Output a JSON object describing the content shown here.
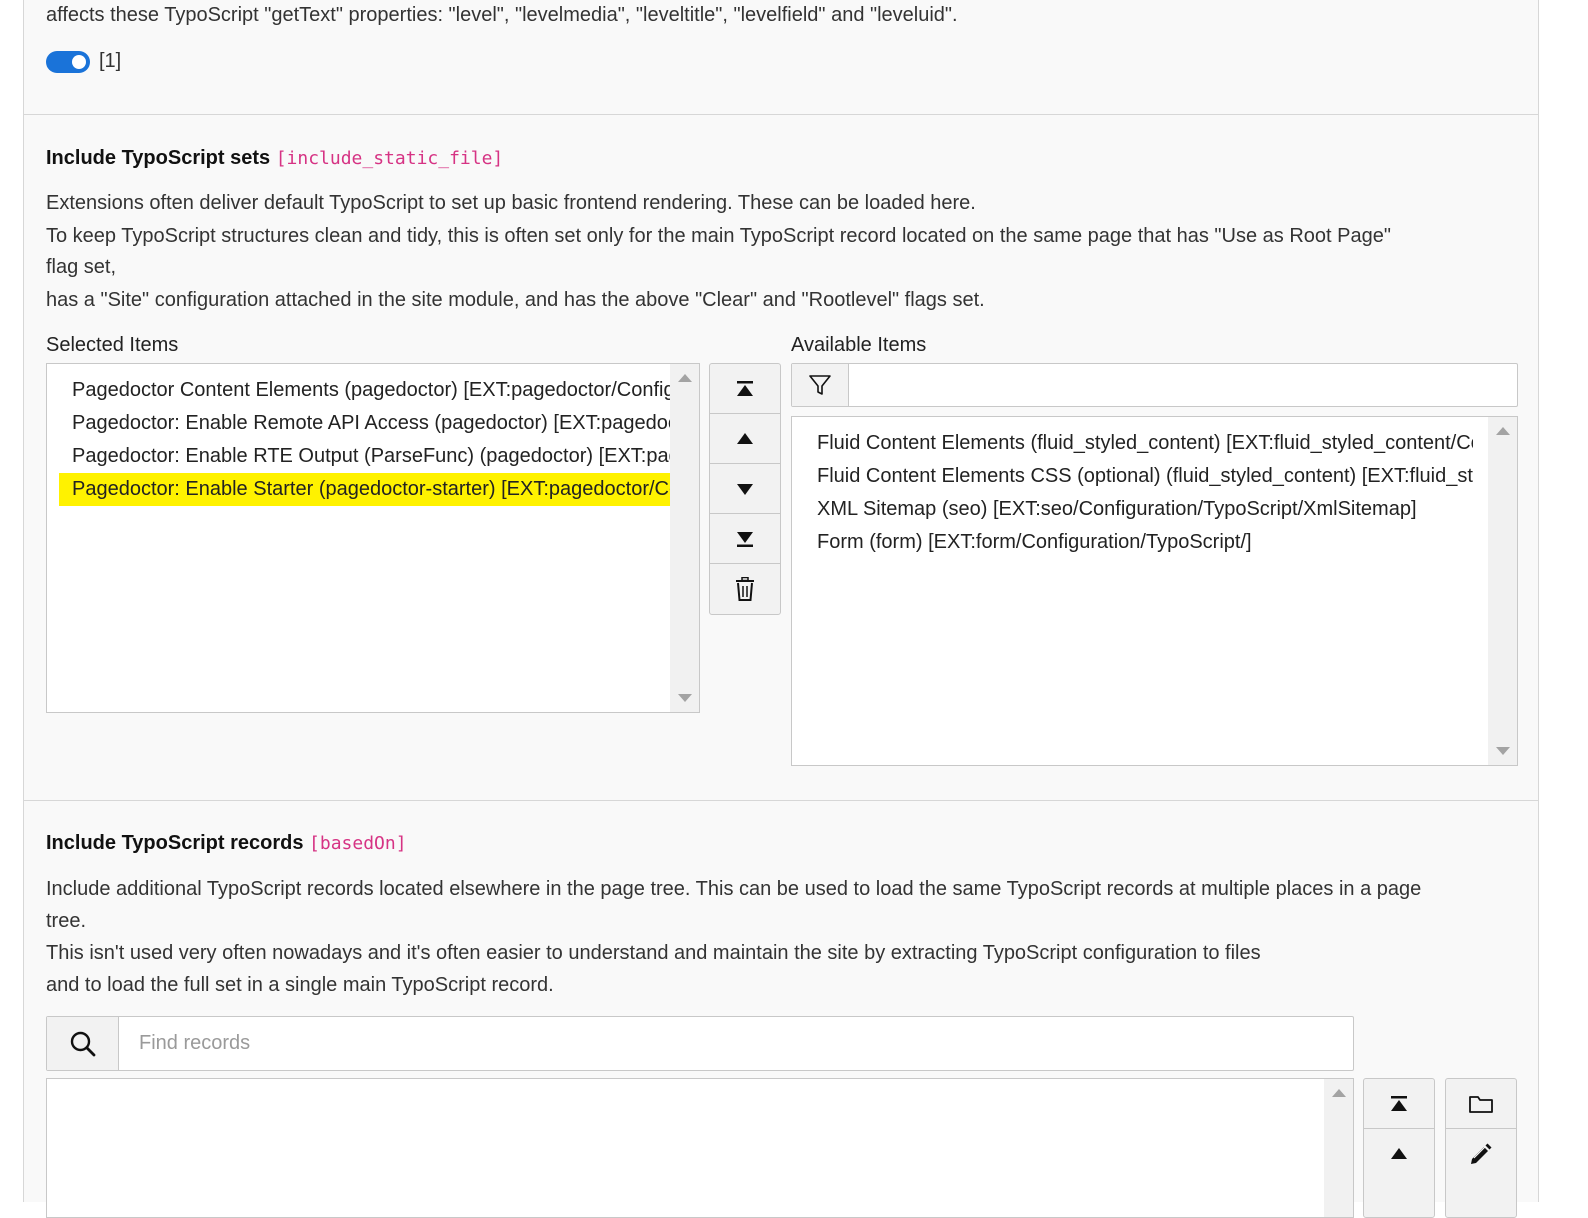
{
  "top": {
    "desc_line": "affects these TypoScript \"getText\" properties: \"level\", \"levelmedia\", \"leveltitle\", \"levelfield\" and \"leveluid\".",
    "toggle_value": "[1]",
    "toggle_on": true
  },
  "include_static": {
    "title": "Include TypoScript sets",
    "field_name": "[include_static_file]",
    "description": [
      "Extensions often deliver default TypoScript to set up basic frontend rendering. These can be loaded here.",
      "To keep TypoScript structures clean and tidy, this is often set only for the main TypoScript record located on the same page that has \"Use as Root Page\"",
      "flag set,",
      "has a \"Site\" configuration attached in the site module, and has the above \"Clear\" and \"Rootlevel\" flags set."
    ],
    "selected_label": "Selected Items",
    "available_label": "Available Items",
    "selected_items": [
      "Pagedoctor Content Elements (pagedoctor) [EXT:pagedoctor/Configuration/TypoScript/]",
      "Pagedoctor: Enable Remote API Access (pagedoctor) [EXT:pagedoctor/Configuration/TypoScript/RemoteApi]",
      "Pagedoctor: Enable RTE Output (ParseFunc) (pagedoctor) [EXT:pagedoctor/Configuration/TypoScript/ParseFunc]",
      "Pagedoctor: Enable Starter (pagedoctor-starter) [EXT:pagedoctor/Configuration/TypoScript/Starter]"
    ],
    "selected_highlight_index": 3,
    "available_items": [
      "Fluid Content Elements (fluid_styled_content) [EXT:fluid_styled_content/Configuration/TypoScript/]",
      "Fluid Content Elements CSS (optional) (fluid_styled_content) [EXT:fluid_styled_content/Configuration/TypoScript/Styling/]",
      "XML Sitemap (seo) [EXT:seo/Configuration/TypoScript/XmlSitemap]",
      "Form (form) [EXT:form/Configuration/TypoScript/]"
    ],
    "filter_value": "",
    "controls": [
      "move-to-top-icon",
      "move-up-icon",
      "move-down-icon",
      "move-to-bottom-icon",
      "trash-icon"
    ]
  },
  "based_on": {
    "title": "Include TypoScript records",
    "field_name": "[basedOn]",
    "description": [
      "Include additional TypoScript records located elsewhere in the page tree. This can be used to load the same TypoScript records at multiple places in a page",
      "tree.",
      "This isn't used very often nowadays and it's often easier to understand and maintain the site by extracting TypoScript configuration to files",
      "and to load the full set in a single main TypoScript record."
    ],
    "search_placeholder": "Find records",
    "search_value": "",
    "controls_left": [
      "move-to-top-icon",
      "move-up-icon"
    ],
    "controls_right": [
      "folder-icon",
      "pencil-icon"
    ]
  },
  "colors": {
    "accent": "#1a73d9",
    "highlight": "#fff200",
    "code": "#d63384"
  }
}
